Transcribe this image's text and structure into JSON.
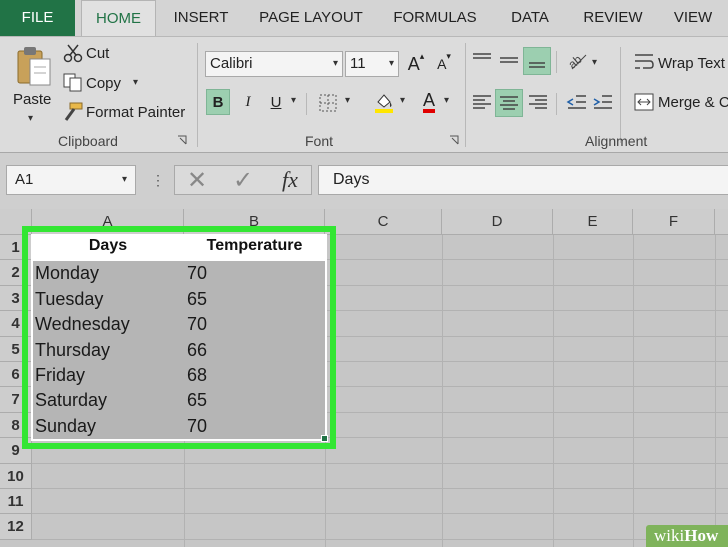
{
  "tabs": [
    "FILE",
    "HOME",
    "INSERT",
    "PAGE LAYOUT",
    "FORMULAS",
    "DATA",
    "REVIEW",
    "VIEW"
  ],
  "clipboard": {
    "paste": "Paste",
    "cut": "Cut",
    "copy": "Copy",
    "format_painter": "Format Painter",
    "group_label": "Clipboard"
  },
  "font": {
    "name": "Calibri",
    "size": "11",
    "bold": "B",
    "italic": "I",
    "underline": "U",
    "grow": "A",
    "shrink": "A",
    "font_color": "A",
    "group_label": "Font"
  },
  "alignment": {
    "wrap_text": "Wrap Text",
    "merge": "Merge & C",
    "group_label": "Alignment"
  },
  "formula_bar": {
    "name_box": "A1",
    "cancel": "✕",
    "enter": "✓",
    "fx": "fx",
    "content": "Days"
  },
  "grid": {
    "columns": [
      "A",
      "B",
      "C",
      "D",
      "E",
      "F"
    ],
    "row_numbers": [
      "1",
      "2",
      "3",
      "4",
      "5",
      "6",
      "7",
      "8",
      "9",
      "10",
      "11",
      "12"
    ],
    "headers": [
      "Days",
      "Temperature"
    ],
    "rows": [
      [
        "Monday",
        "70"
      ],
      [
        "Tuesday",
        "65"
      ],
      [
        "Wednesday",
        "70"
      ],
      [
        "Thursday",
        "66"
      ],
      [
        "Friday",
        "68"
      ],
      [
        "Saturday",
        "65"
      ],
      [
        "Sunday",
        "70"
      ]
    ]
  },
  "watermark": {
    "wiki": "wiki",
    "how": "How"
  },
  "colors": {
    "excel_green": "#217346",
    "selection_highlight": "#33e633",
    "active_button": "#9ccfb0"
  }
}
